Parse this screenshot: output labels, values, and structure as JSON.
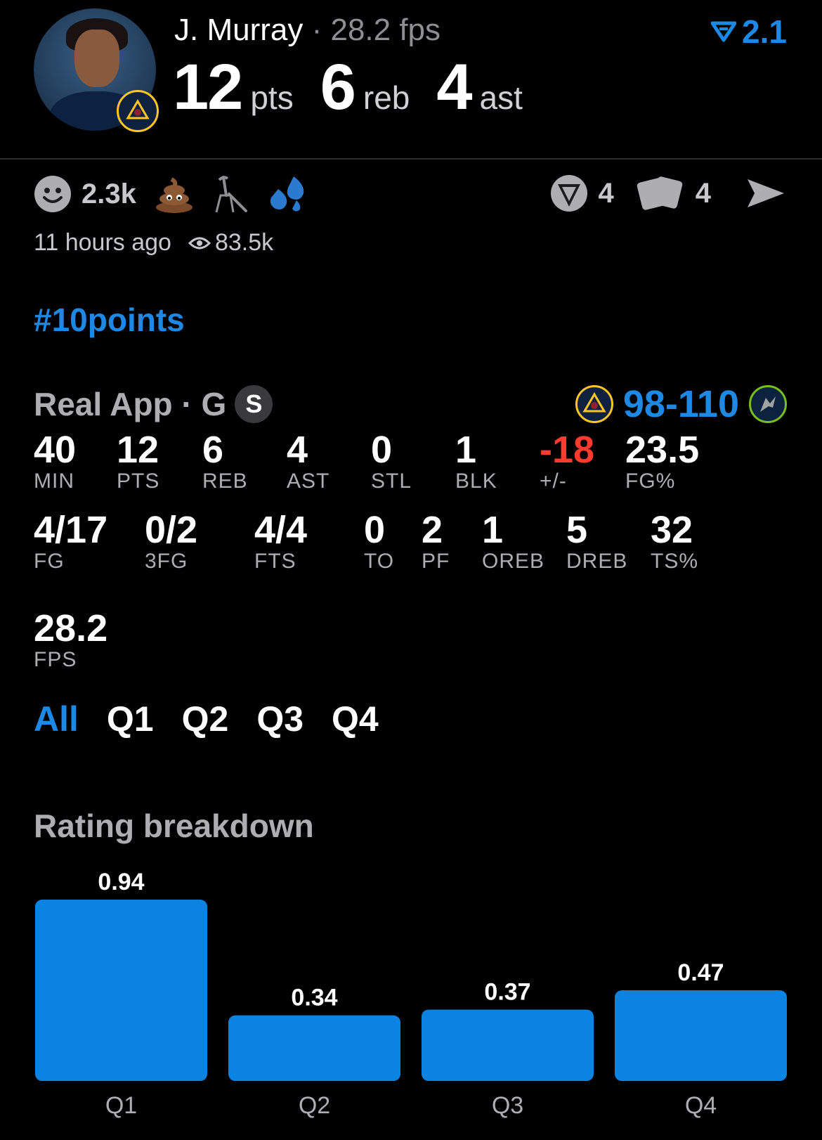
{
  "player": {
    "name": "J. Murray",
    "fps_label": "· 28.2 fps",
    "stats": [
      {
        "value": "12",
        "unit": "pts"
      },
      {
        "value": "6",
        "unit": "reb"
      },
      {
        "value": "4",
        "unit": "ast"
      }
    ],
    "rating": "2.1"
  },
  "reactions": {
    "count": "2.3k",
    "icons": [
      "smile-icon",
      "poop-emoji-icon",
      "broom-icon",
      "sweat-drops-icon"
    ]
  },
  "actions": {
    "comments_count": "4",
    "cards_count": "4"
  },
  "meta": {
    "time_ago": "11 hours ago",
    "views": "83.5k"
  },
  "hashtag": "#10points",
  "game": {
    "label": "Real App · G",
    "badge": "S",
    "score": "98-110"
  },
  "box_score": [
    [
      {
        "value": "40",
        "label": "MIN"
      },
      {
        "value": "12",
        "label": "PTS"
      },
      {
        "value": "6",
        "label": "REB"
      },
      {
        "value": "4",
        "label": "AST"
      },
      {
        "value": "0",
        "label": "STL"
      },
      {
        "value": "1",
        "label": "BLK"
      },
      {
        "value": "-18",
        "label": "+/-"
      },
      {
        "value": "23.5",
        "label": "FG%"
      }
    ],
    [
      {
        "value": "4/17",
        "label": "FG"
      },
      {
        "value": "0/2",
        "label": "3FG"
      },
      {
        "value": "4/4",
        "label": "FTS"
      },
      {
        "value": "0",
        "label": "TO"
      },
      {
        "value": "2",
        "label": "PF"
      },
      {
        "value": "1",
        "label": "OREB"
      },
      {
        "value": "5",
        "label": "DREB"
      },
      {
        "value": "32",
        "label": "TS%"
      }
    ],
    [
      {
        "value": "28.2",
        "label": "FPS"
      }
    ]
  ],
  "tabs": [
    "All",
    "Q1",
    "Q2",
    "Q3",
    "Q4"
  ],
  "active_tab": 0,
  "rating_breakdown_title": "Rating breakdown",
  "colors": {
    "accent": "#1e88e5",
    "negative": "#ff3b30",
    "bar": "#0a84e0"
  },
  "chart_data": {
    "type": "bar",
    "categories": [
      "Q1",
      "Q2",
      "Q3",
      "Q4"
    ],
    "values": [
      0.94,
      0.34,
      0.37,
      0.47
    ],
    "title": "Rating breakdown",
    "ylim": [
      0,
      0.94
    ]
  }
}
